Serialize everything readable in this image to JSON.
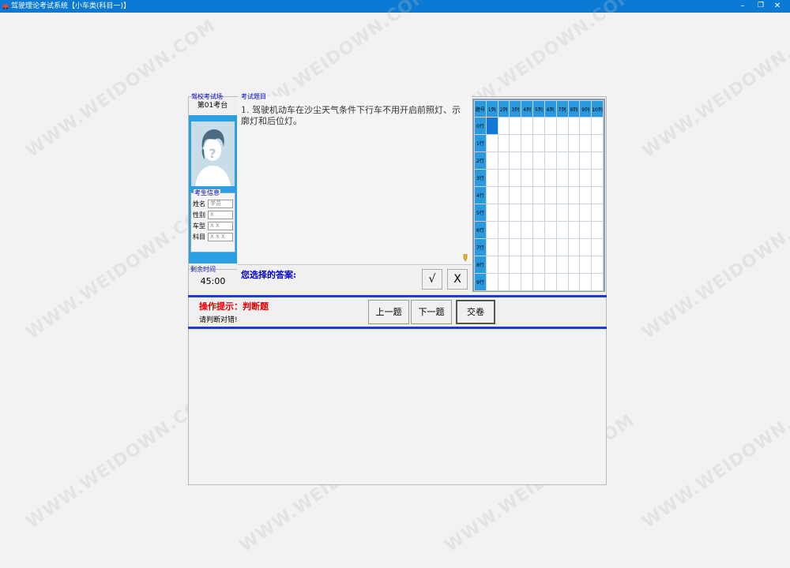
{
  "window": {
    "title": "驾驶理论考试系统【小车类(科目一)】",
    "minimize_glyph": "–",
    "maximize_glyph": "❐",
    "close_glyph": "✕"
  },
  "exam_site": {
    "group_title": "驾校考试场",
    "booth": "第01考台"
  },
  "examinee": {
    "group_title": "考生信息",
    "fields": [
      {
        "label": "姓名",
        "value": "学员"
      },
      {
        "label": "性别",
        "value": "X"
      },
      {
        "label": "车型",
        "value": "X X"
      },
      {
        "label": "科目",
        "value": "X X X"
      }
    ]
  },
  "timer": {
    "group_title": "剩余时间",
    "value": "45:00"
  },
  "question": {
    "group_title": "考试题目",
    "text": "1. 驾驶机动车在沙尘天气条件下行车不用开启前照灯、示廓灯和后位灯。"
  },
  "answer": {
    "label": "您选择的答案:",
    "true_glyph": "√",
    "false_glyph": "X"
  },
  "answer_grid": {
    "corner": "题号",
    "columns": [
      "1列",
      "2列",
      "3列",
      "4列",
      "5列",
      "6列",
      "7列",
      "8列",
      "9列",
      "10列"
    ],
    "rows": [
      "0行",
      "1行",
      "2行",
      "3行",
      "4行",
      "5行",
      "6行",
      "7行",
      "8行",
      "9行"
    ],
    "current_cell": [
      0,
      0
    ],
    "current_color": "#1478d6",
    "header_color": "#2a9ae0"
  },
  "hint": {
    "title": "操作提示：判断题",
    "text": "请判断对错!"
  },
  "nav": {
    "prev_label": "上一题",
    "next_label": "下一题",
    "submit_label": "交卷"
  },
  "colors": {
    "titlebar": "#0a7ad4",
    "panel_blue": "#2aa0e2",
    "divider_blue": "#1c3fc0",
    "hint_red": "#e00000",
    "label_blue": "#0000cc"
  },
  "watermark": "WWW.WEIDOWN.COM"
}
